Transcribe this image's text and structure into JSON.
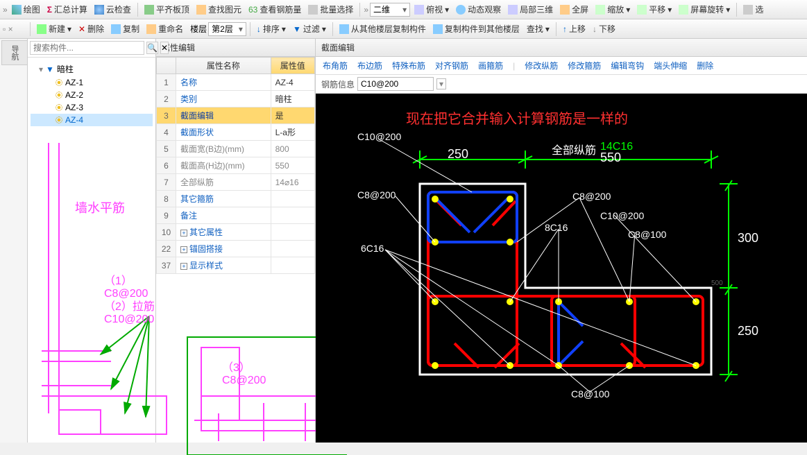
{
  "toolbar1": {
    "items": [
      "绘图",
      "汇总计算",
      "云检查",
      "平齐板顶",
      "查找图元",
      "查看钢筋量",
      "批量选择"
    ],
    "view_dd": "二维",
    "items2": [
      "俯视",
      "动态观察",
      "局部三维",
      "全屏",
      "缩放",
      "平移",
      "屏幕旋转",
      "选"
    ]
  },
  "toolbar2": {
    "items": [
      "新建",
      "删除",
      "复制",
      "重命名"
    ],
    "floor_label": "楼层",
    "floor_dd": "第2层",
    "items2": [
      "排序",
      "过滤",
      "从其他楼层复制构件",
      "复制构件到其他楼层",
      "查找"
    ],
    "items3": [
      "上移",
      "下移"
    ]
  },
  "left_tab": "导航",
  "search": {
    "placeholder": "搜索构件..."
  },
  "tree": {
    "root": "暗柱",
    "items": [
      "AZ-1",
      "AZ-2",
      "AZ-3",
      "AZ-4"
    ],
    "selected": 3
  },
  "left_annotations": {
    "a1": "墙水平筋",
    "a2": "（1）C8@200",
    "a3": "（2）拉筋C10@200",
    "a4": "（3）C8@200"
  },
  "prop": {
    "title": "属性编辑",
    "col_name": "属性名称",
    "col_val": "属性值",
    "rows": [
      {
        "n": "1",
        "name": "名称",
        "val": "AZ-4",
        "link": true
      },
      {
        "n": "2",
        "name": "类别",
        "val": "暗柱",
        "link": true
      },
      {
        "n": "3",
        "name": "截面编辑",
        "val": "是",
        "link": true,
        "sel": true
      },
      {
        "n": "4",
        "name": "截面形状",
        "val": "L-a形",
        "link": true
      },
      {
        "n": "5",
        "name": "截面宽(B边)(mm)",
        "val": "800",
        "dim": true
      },
      {
        "n": "6",
        "name": "截面高(H边)(mm)",
        "val": "550",
        "dim": true
      },
      {
        "n": "7",
        "name": "全部纵筋",
        "val": "14⌀16",
        "dim": true
      },
      {
        "n": "8",
        "name": "其它箍筋",
        "val": "",
        "link": true
      },
      {
        "n": "9",
        "name": "备注",
        "val": "",
        "link": true
      },
      {
        "n": "10",
        "name": "其它属性",
        "val": "",
        "exp": true
      },
      {
        "n": "22",
        "name": "锚固搭接",
        "val": "",
        "exp": true
      },
      {
        "n": "37",
        "name": "显示样式",
        "val": "",
        "exp": true
      }
    ]
  },
  "section": {
    "title": "截面编辑",
    "tabs": [
      "布角筋",
      "布边筋",
      "特殊布筋",
      "对齐钢筋",
      "画箍筋",
      "修改纵筋",
      "修改箍筋",
      "编辑弯钩",
      "端头伸缩",
      "删除"
    ],
    "rebar_label": "钢筋信息",
    "rebar_val": "C10@200",
    "top_note": "现在把它合并输入计算钢筋是一样的",
    "labels": {
      "c10_200_a": "C10@200",
      "c8_200_a": "C8@200",
      "c8_200_b": "C8@200",
      "c10_200_b": "C10@200",
      "c8_100_a": "C8@100",
      "c8_100_b": "C8@100",
      "n8c16": "8C16",
      "n6c16": "6C16",
      "dim250a": "250",
      "dim550": "550",
      "dim300": "300",
      "dim250b": "250",
      "all_long": "全部纵筋",
      "all_long_v": "14C16",
      "tick500": "500"
    }
  }
}
